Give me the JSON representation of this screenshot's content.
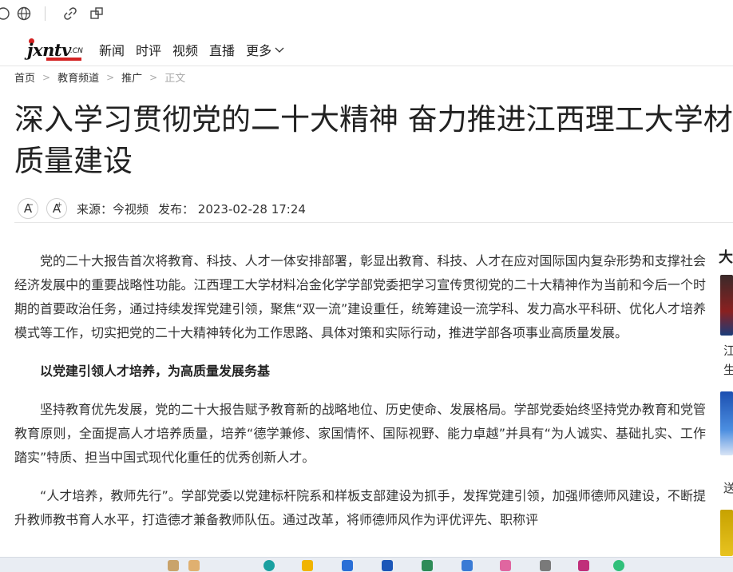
{
  "browser": {
    "icons": [
      "info-icon",
      "globe-icon",
      "link-icon",
      "extension-icon"
    ]
  },
  "site": {
    "logo_text": "jxntv",
    "logo_suffix": ".CN",
    "nav": [
      "新闻",
      "时评",
      "视频",
      "直播",
      "更多"
    ],
    "accent": "#d32222"
  },
  "breadcrumb": [
    "首页",
    "教育频道",
    "推广",
    "正文"
  ],
  "article": {
    "title_line1": "深入学习贯彻党的二十大精神 奋力推进江西理工大学材料",
    "title_line2": "质量建设",
    "font_decrease": "A",
    "font_increase": "A",
    "source": "来源：今视频",
    "published": "发布：  2023-02-28 17:24",
    "paragraphs": [
      "党的二十大报告首次将教育、科技、人才一体安排部署，彰显出教育、科技、人才在应对国际国内复杂形势和支撑社会经济发展中的重要战略性功能。江西理工大学材料冶金化学学部党委把学习宣传贯彻党的二十大精神作为当前和今后一个时期的首要政治任务，通过持续发挥党建引领，聚焦“双一流”建设重任，统筹建设一流学科、发力高水平科研、优化人才培养模式等工作，切实把党的二十大精神转化为工作思路、具体对策和实际行动，推进学部各项事业高质量发展。",
      "以党建引领人才培养，为高质量发展务基",
      "坚持教育优先发展，党的二十大报告赋予教育新的战略地位、历史使命、发展格局。学部党委始终坚持党办教育和党管教育原则，全面提高人才培养质量，培养“德学兼修、家国情怀、国际视野、能力卓越”并具有“为人诚实、基础扎实、工作踏实”特质、担当中国式现代化重任的优秀创新人才。",
      "“人才培养，教师先行”。学部党委以党建标杆院系和样板支部建设为抓手，发挥党建引领，加强师德师风建设，不断提升教师教书育人水平，打造德才兼备教师队伍。通过改革，将师德师风作为评优评先、职称评"
    ]
  },
  "sidebar": {
    "heading": "大",
    "snippets": [
      "江",
      "生",
      "送"
    ]
  }
}
